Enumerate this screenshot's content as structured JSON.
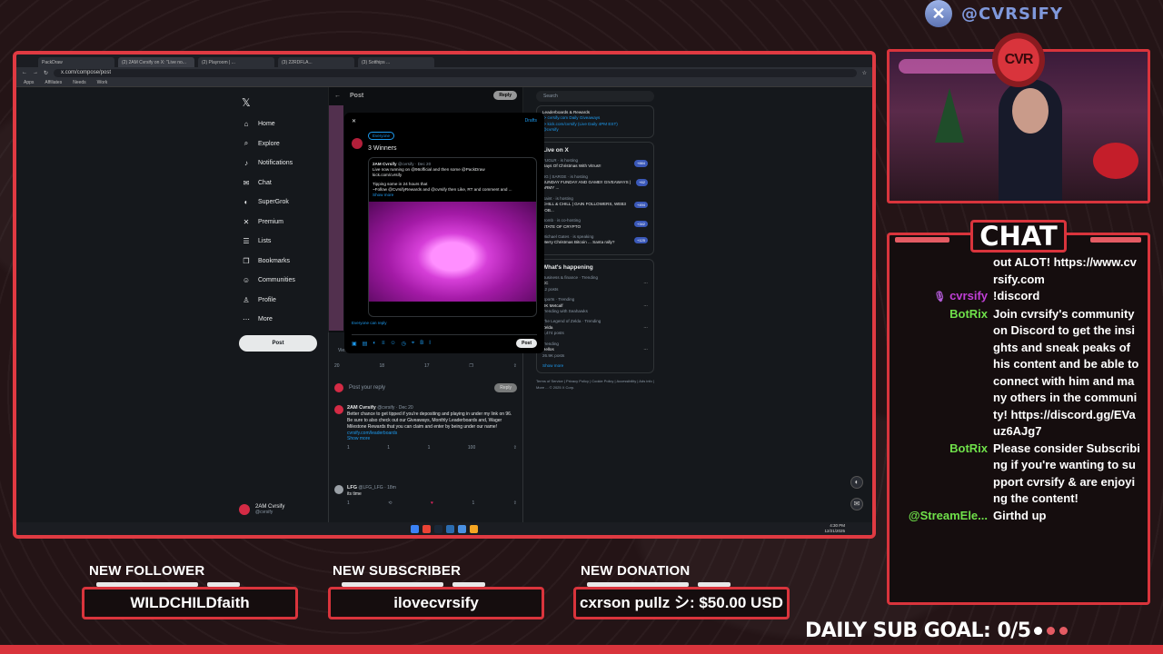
{
  "brand": {
    "handle": "@CVRSIFY",
    "icon": "x-logo-icon"
  },
  "browser": {
    "tabs": [
      "PackDraw",
      "(2) 2AM Cvrsify on X: \"Live no...",
      "(2) Playroom | ...",
      "(3) 22RDFLA...",
      "(3) Sotthips ..."
    ],
    "url": "x.com/compose/post",
    "bookmarks": [
      "Apps",
      "Affiliates",
      "Needs",
      "Work"
    ]
  },
  "x": {
    "nav": [
      {
        "label": "Home",
        "icon": "home-icon"
      },
      {
        "label": "Explore",
        "icon": "search-icon"
      },
      {
        "label": "Notifications",
        "icon": "bell-icon"
      },
      {
        "label": "Chat",
        "icon": "mail-icon"
      },
      {
        "label": "SuperGrok",
        "icon": "grok-icon"
      },
      {
        "label": "Premium",
        "icon": "x-icon"
      },
      {
        "label": "Lists",
        "icon": "list-icon"
      },
      {
        "label": "Bookmarks",
        "icon": "bookmark-icon"
      },
      {
        "label": "Communities",
        "icon": "people-icon"
      },
      {
        "label": "Profile",
        "icon": "person-icon"
      },
      {
        "label": "More",
        "icon": "more-icon"
      }
    ],
    "post_button": "Post",
    "profile": {
      "name": "2AM Cvrsify",
      "handle": "@cvrsify"
    },
    "main": {
      "title": "Post",
      "reply_btn": "Reply",
      "engagements": "View post engagements",
      "actions": [
        "20",
        "18",
        "17",
        "",
        ""
      ],
      "reply_placeholder": "Post your reply",
      "reply_submit": "Reply",
      "reply1": {
        "name": "2AM Cvrsify",
        "meta": "@cvrsify · Dec 20",
        "text": "Better chance to get tipped if you're depositing and playing in under my link on 96. Be sure to also check out our Giveaways, Monthly Leaderboards and, Wager Milestone Rewards that you can claim and enter by being under our name!",
        "link": "cvrsify.com/leaderboards",
        "more": "Show more",
        "stats": [
          "1",
          "1",
          "1",
          "100",
          ""
        ]
      },
      "reply2": {
        "name": "LFG",
        "meta": "@LFG_LFG · 18m",
        "text": "its time",
        "stats": [
          "1",
          "",
          "",
          "1",
          ""
        ]
      }
    },
    "right": {
      "search_placeholder": "Search",
      "top_text": "Leaderboards & Rewards",
      "top_lines": [
        "-> cvrsify.com Daily Giveaways",
        "-> kick.com/cvrsify (Live Daily 4PM EST)",
        "@cvrsify"
      ],
      "live_title": "Live on X",
      "live": [
        {
          "host": "FUGLR · is hosting",
          "title": "Days Of Christmas With Vitrus!!",
          "count": "+884"
        },
        {
          "host": "BG | SARGE · is hosting",
          "title": "SUNDAY FUNDAY AND GAME!! GIVEAWAYS | ARMY ...",
          "count": "+62"
        },
        {
          "host": "Saint · is hosting",
          "title": "CHILL & CHILL | GAIN FOLLOWERS, WEB3 JOB...",
          "count": "+494"
        },
        {
          "host": "Bomb · is co-hosting",
          "title": "STATE OF CRYPTO",
          "count": "+342"
        },
        {
          "host": "Michael Gates · is speaking",
          "title": "Merry Christmas Bitcoin ... Santa rally?",
          "count": "+125"
        }
      ],
      "happening_title": "What's happening",
      "trends": [
        {
          "meta": "Business & finance · Trending",
          "name": "XC",
          "count": "12 posts"
        },
        {
          "meta": "Sports · Trending",
          "name": "DK Metcalf",
          "count": "Trending with Seahawks"
        },
        {
          "meta": "The Legend of Zelda · Trending",
          "name": "Zelda",
          "count": "8,474 posts"
        },
        {
          "meta": "Trending",
          "name": "Hellos",
          "count": "26.9K posts"
        }
      ],
      "show_more": "Show more",
      "footer": "Terms of Service | Privacy Policy | Cookie Policy | Accessibility | Ads info | More ... © 2025 X Corp."
    },
    "modal": {
      "drafts": "Drafts",
      "audience": "Everyone",
      "text": "3 Winners",
      "quote": {
        "name": "2AM Cvrsify",
        "meta": "@cvrsify · Dec 20",
        "line1": "Live now running on @96official and then some @PackDraw",
        "line2": "kick.com/cvrsify",
        "line3": "Tipping some in 24 hours that",
        "line4": "~Follow @CvrsifyRewards and @cvrsify then Like, RT and comment and ...",
        "more": "Show more"
      },
      "reply_note": "Everyone can reply",
      "post_btn": "Post"
    },
    "clock": {
      "time": "4:30 PM",
      "date": "12/21/2025"
    }
  },
  "chat": {
    "title": "CHAT",
    "messages": [
      {
        "who": "",
        "text": "out ALOT! https://www.cvrsify.com",
        "cls": ""
      },
      {
        "who": "cvrsify",
        "text": "!discord",
        "cls": "cvrsify",
        "mic": true
      },
      {
        "who": "BotRix",
        "text": "Join cvrsify's community on Discord to get the insights and sneak peaks of his content and be able to connect with him and many others in the community! https://discord.gg/EVauz6AJg7",
        "cls": "botrix"
      },
      {
        "who": "BotRix",
        "text": "Please consider Subscribing if you're wanting to support cvrsify & are enjoying the content!",
        "cls": "botrix"
      },
      {
        "who": "@StreamEle...",
        "text": "Girthd up",
        "cls": "streamele"
      }
    ]
  },
  "alerts": {
    "follower": {
      "label": "NEW FOLLOWER",
      "value": "WILDCHILDfaith"
    },
    "subscriber": {
      "label": "NEW SUBSCRIBER",
      "value": "ilovecvrsify"
    },
    "donation": {
      "label": "NEW DONATION",
      "value": "cxrson pullz シ: $50.00 USD"
    }
  },
  "sub_goal": "DAILY SUB GOAL: 0/5",
  "colors": {
    "accent": "#d9343c",
    "chat_title_bg": "#150d0e",
    "botrix": "#6fe04a",
    "cvrsify": "#c03fd6"
  }
}
